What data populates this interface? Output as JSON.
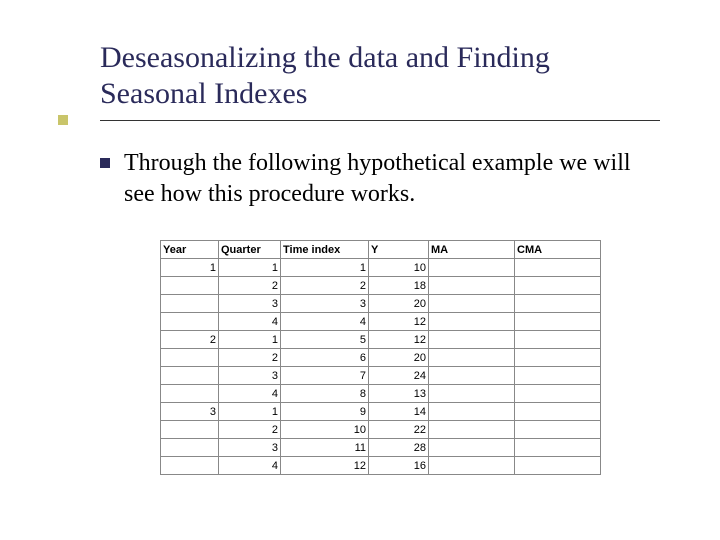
{
  "title": "Deseasonalizing the data and Finding Seasonal Indexes",
  "body_text": "Through the following hypothetical example we will see how this procedure works.",
  "table": {
    "headers": [
      "Year",
      "Quarter",
      "Time index",
      "Y",
      "MA",
      "CMA"
    ],
    "rows": [
      {
        "year": "1",
        "quarter": "1",
        "time": "1",
        "y": "10",
        "ma": "",
        "cma": ""
      },
      {
        "year": "",
        "quarter": "2",
        "time": "2",
        "y": "18",
        "ma": "",
        "cma": ""
      },
      {
        "year": "",
        "quarter": "3",
        "time": "3",
        "y": "20",
        "ma": "",
        "cma": ""
      },
      {
        "year": "",
        "quarter": "4",
        "time": "4",
        "y": "12",
        "ma": "",
        "cma": ""
      },
      {
        "year": "2",
        "quarter": "1",
        "time": "5",
        "y": "12",
        "ma": "",
        "cma": ""
      },
      {
        "year": "",
        "quarter": "2",
        "time": "6",
        "y": "20",
        "ma": "",
        "cma": ""
      },
      {
        "year": "",
        "quarter": "3",
        "time": "7",
        "y": "24",
        "ma": "",
        "cma": ""
      },
      {
        "year": "",
        "quarter": "4",
        "time": "8",
        "y": "13",
        "ma": "",
        "cma": ""
      },
      {
        "year": "3",
        "quarter": "1",
        "time": "9",
        "y": "14",
        "ma": "",
        "cma": ""
      },
      {
        "year": "",
        "quarter": "2",
        "time": "10",
        "y": "22",
        "ma": "",
        "cma": ""
      },
      {
        "year": "",
        "quarter": "3",
        "time": "11",
        "y": "28",
        "ma": "",
        "cma": ""
      },
      {
        "year": "",
        "quarter": "4",
        "time": "12",
        "y": "16",
        "ma": "",
        "cma": ""
      }
    ]
  }
}
